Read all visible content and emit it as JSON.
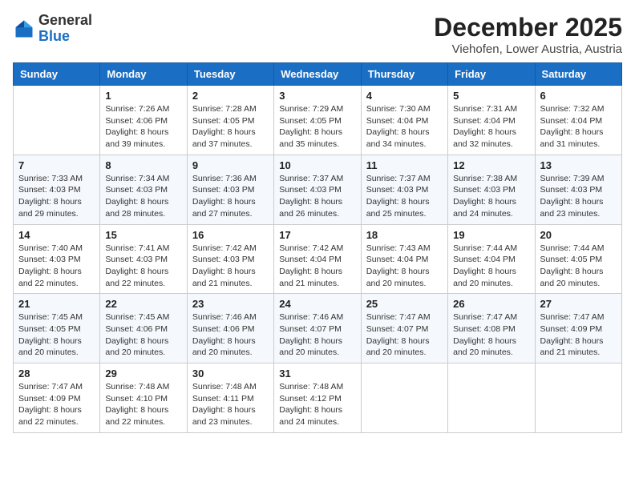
{
  "header": {
    "logo_general": "General",
    "logo_blue": "Blue",
    "month_title": "December 2025",
    "location": "Viehofen, Lower Austria, Austria"
  },
  "days_of_week": [
    "Sunday",
    "Monday",
    "Tuesday",
    "Wednesday",
    "Thursday",
    "Friday",
    "Saturday"
  ],
  "weeks": [
    [
      {
        "day": "",
        "info": ""
      },
      {
        "day": "1",
        "info": "Sunrise: 7:26 AM\nSunset: 4:06 PM\nDaylight: 8 hours\nand 39 minutes."
      },
      {
        "day": "2",
        "info": "Sunrise: 7:28 AM\nSunset: 4:05 PM\nDaylight: 8 hours\nand 37 minutes."
      },
      {
        "day": "3",
        "info": "Sunrise: 7:29 AM\nSunset: 4:05 PM\nDaylight: 8 hours\nand 35 minutes."
      },
      {
        "day": "4",
        "info": "Sunrise: 7:30 AM\nSunset: 4:04 PM\nDaylight: 8 hours\nand 34 minutes."
      },
      {
        "day": "5",
        "info": "Sunrise: 7:31 AM\nSunset: 4:04 PM\nDaylight: 8 hours\nand 32 minutes."
      },
      {
        "day": "6",
        "info": "Sunrise: 7:32 AM\nSunset: 4:04 PM\nDaylight: 8 hours\nand 31 minutes."
      }
    ],
    [
      {
        "day": "7",
        "info": "Sunrise: 7:33 AM\nSunset: 4:03 PM\nDaylight: 8 hours\nand 29 minutes."
      },
      {
        "day": "8",
        "info": "Sunrise: 7:34 AM\nSunset: 4:03 PM\nDaylight: 8 hours\nand 28 minutes."
      },
      {
        "day": "9",
        "info": "Sunrise: 7:36 AM\nSunset: 4:03 PM\nDaylight: 8 hours\nand 27 minutes."
      },
      {
        "day": "10",
        "info": "Sunrise: 7:37 AM\nSunset: 4:03 PM\nDaylight: 8 hours\nand 26 minutes."
      },
      {
        "day": "11",
        "info": "Sunrise: 7:37 AM\nSunset: 4:03 PM\nDaylight: 8 hours\nand 25 minutes."
      },
      {
        "day": "12",
        "info": "Sunrise: 7:38 AM\nSunset: 4:03 PM\nDaylight: 8 hours\nand 24 minutes."
      },
      {
        "day": "13",
        "info": "Sunrise: 7:39 AM\nSunset: 4:03 PM\nDaylight: 8 hours\nand 23 minutes."
      }
    ],
    [
      {
        "day": "14",
        "info": "Sunrise: 7:40 AM\nSunset: 4:03 PM\nDaylight: 8 hours\nand 22 minutes."
      },
      {
        "day": "15",
        "info": "Sunrise: 7:41 AM\nSunset: 4:03 PM\nDaylight: 8 hours\nand 22 minutes."
      },
      {
        "day": "16",
        "info": "Sunrise: 7:42 AM\nSunset: 4:03 PM\nDaylight: 8 hours\nand 21 minutes."
      },
      {
        "day": "17",
        "info": "Sunrise: 7:42 AM\nSunset: 4:04 PM\nDaylight: 8 hours\nand 21 minutes."
      },
      {
        "day": "18",
        "info": "Sunrise: 7:43 AM\nSunset: 4:04 PM\nDaylight: 8 hours\nand 20 minutes."
      },
      {
        "day": "19",
        "info": "Sunrise: 7:44 AM\nSunset: 4:04 PM\nDaylight: 8 hours\nand 20 minutes."
      },
      {
        "day": "20",
        "info": "Sunrise: 7:44 AM\nSunset: 4:05 PM\nDaylight: 8 hours\nand 20 minutes."
      }
    ],
    [
      {
        "day": "21",
        "info": "Sunrise: 7:45 AM\nSunset: 4:05 PM\nDaylight: 8 hours\nand 20 minutes."
      },
      {
        "day": "22",
        "info": "Sunrise: 7:45 AM\nSunset: 4:06 PM\nDaylight: 8 hours\nand 20 minutes."
      },
      {
        "day": "23",
        "info": "Sunrise: 7:46 AM\nSunset: 4:06 PM\nDaylight: 8 hours\nand 20 minutes."
      },
      {
        "day": "24",
        "info": "Sunrise: 7:46 AM\nSunset: 4:07 PM\nDaylight: 8 hours\nand 20 minutes."
      },
      {
        "day": "25",
        "info": "Sunrise: 7:47 AM\nSunset: 4:07 PM\nDaylight: 8 hours\nand 20 minutes."
      },
      {
        "day": "26",
        "info": "Sunrise: 7:47 AM\nSunset: 4:08 PM\nDaylight: 8 hours\nand 20 minutes."
      },
      {
        "day": "27",
        "info": "Sunrise: 7:47 AM\nSunset: 4:09 PM\nDaylight: 8 hours\nand 21 minutes."
      }
    ],
    [
      {
        "day": "28",
        "info": "Sunrise: 7:47 AM\nSunset: 4:09 PM\nDaylight: 8 hours\nand 22 minutes."
      },
      {
        "day": "29",
        "info": "Sunrise: 7:48 AM\nSunset: 4:10 PM\nDaylight: 8 hours\nand 22 minutes."
      },
      {
        "day": "30",
        "info": "Sunrise: 7:48 AM\nSunset: 4:11 PM\nDaylight: 8 hours\nand 23 minutes."
      },
      {
        "day": "31",
        "info": "Sunrise: 7:48 AM\nSunset: 4:12 PM\nDaylight: 8 hours\nand 24 minutes."
      },
      {
        "day": "",
        "info": ""
      },
      {
        "day": "",
        "info": ""
      },
      {
        "day": "",
        "info": ""
      }
    ]
  ]
}
